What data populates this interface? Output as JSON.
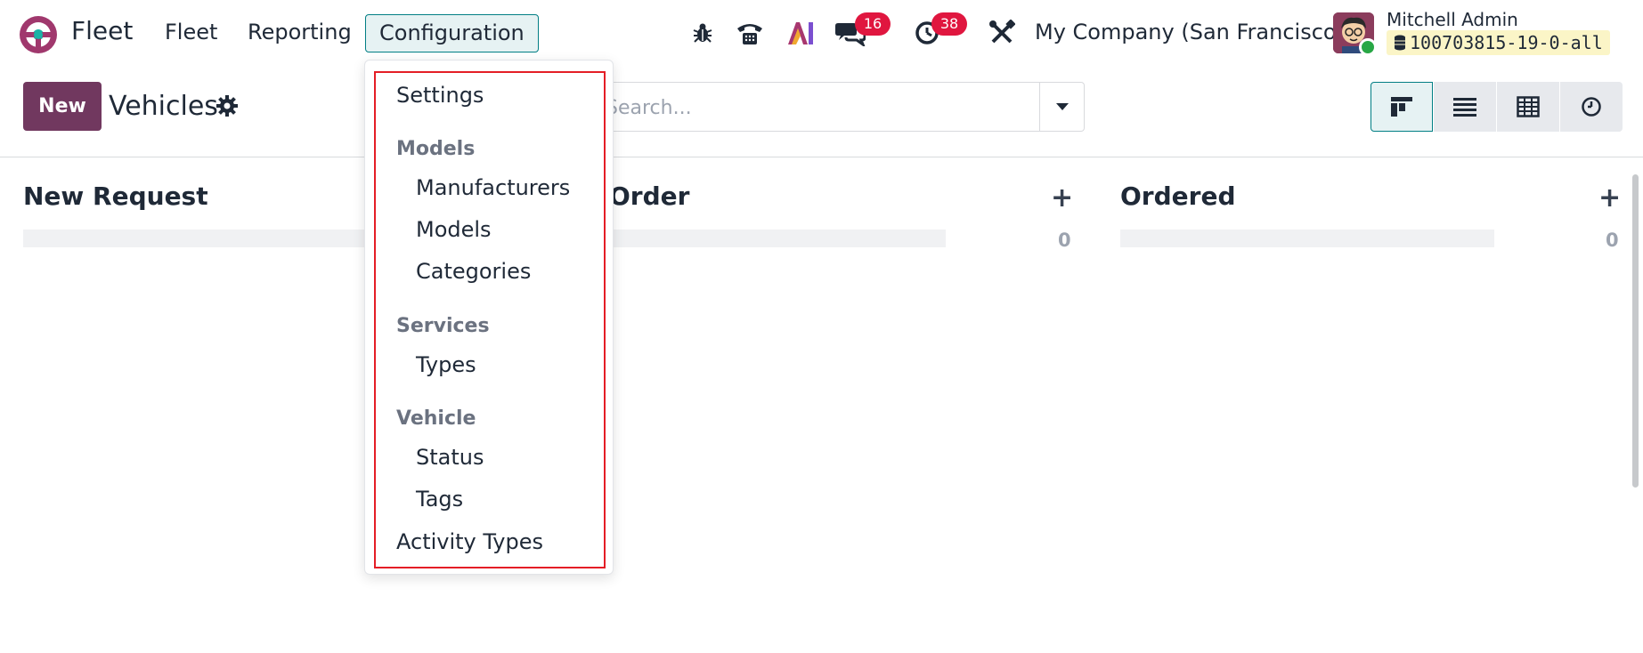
{
  "navbar": {
    "app_name": "Fleet",
    "menu": {
      "fleet": "Fleet",
      "reporting": "Reporting",
      "configuration": "Configuration"
    },
    "messages_count": "16",
    "activities_count": "38",
    "company": "My Company (San Francisco)",
    "user_name": "Mitchell Admin",
    "database": "100703815-19-0-all",
    "icons": [
      "bug-icon",
      "phone-icon",
      "ai-icon",
      "chat-icon",
      "clock-icon",
      "tools-icon"
    ]
  },
  "control_panel": {
    "new_label": "New",
    "title": "Vehicles",
    "search_placeholder": "Search..."
  },
  "views": [
    "kanban",
    "list",
    "pivot",
    "activity"
  ],
  "kanban": {
    "columns": [
      {
        "title": "New Request",
        "count": ""
      },
      {
        "title": "Order",
        "count": "0"
      },
      {
        "title": "Ordered",
        "count": "0"
      }
    ]
  },
  "dropdown": {
    "settings": "Settings",
    "models_header": "Models",
    "manufacturers": "Manufacturers",
    "models": "Models",
    "categories": "Categories",
    "services_header": "Services",
    "types": "Types",
    "vehicle_header": "Vehicle",
    "status": "Status",
    "tags": "Tags",
    "activity_types": "Activity Types"
  },
  "colors": {
    "brand": "#71385f",
    "accent": "#017e84",
    "badge": "#e0163f",
    "highlight_frame": "#e41e26"
  }
}
